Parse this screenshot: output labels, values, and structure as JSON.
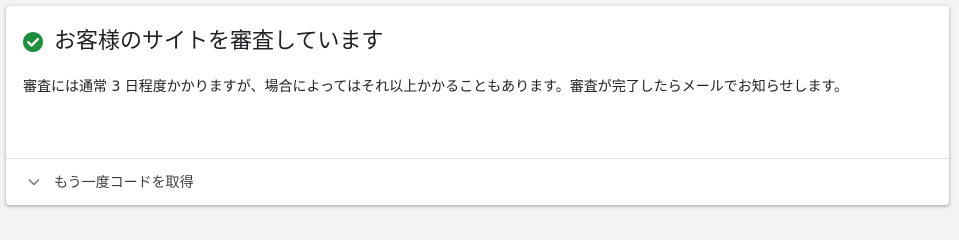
{
  "status": {
    "icon": "check-circle-icon",
    "color": "#1e8e3e",
    "title": "お客様のサイトを審査しています",
    "description": "審査には通常 3 日程度かかりますが、場合によってはそれ以上かかることもあります。審査が完了したらメールでお知らせします。"
  },
  "expander": {
    "icon": "chevron-down-icon",
    "label": "もう一度コードを取得"
  }
}
